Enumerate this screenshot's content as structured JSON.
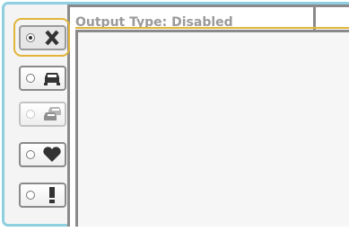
{
  "panel": {
    "title": "Output Type: Disabled"
  },
  "output_options": [
    {
      "name": "disabled",
      "icon": "x-icon",
      "selected": true,
      "enabled": true
    },
    {
      "name": "single-vehicle",
      "icon": "car-icon",
      "selected": false,
      "enabled": true
    },
    {
      "name": "multiple-vehicles",
      "icon": "cars-icon",
      "selected": false,
      "enabled": false
    },
    {
      "name": "favorite",
      "icon": "heart-icon",
      "selected": false,
      "enabled": true
    },
    {
      "name": "alert",
      "icon": "exclamation-icon",
      "selected": false,
      "enabled": true
    }
  ],
  "colors": {
    "frame_border": "#8ecfe0",
    "highlight": "#e2b43a",
    "panel_border": "#8a8a8a",
    "icon_dark": "#333333",
    "icon_disabled": "#b5b5b5",
    "title_text": "#9a9a9a"
  }
}
